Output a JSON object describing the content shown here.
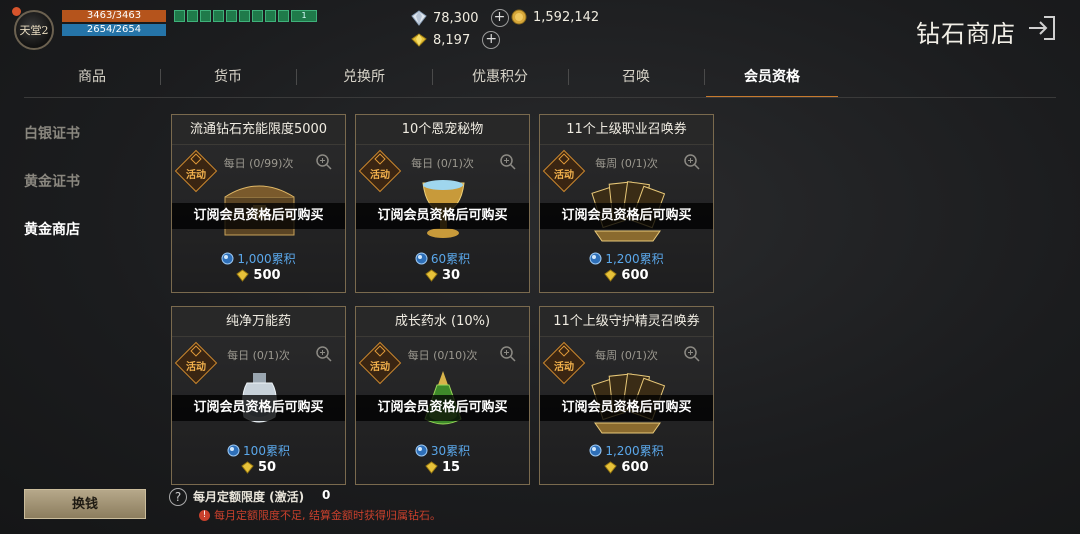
{
  "hud": {
    "avatar_text": "天堂2",
    "hp": "3463/3463",
    "mp": "2654/2654",
    "buff_tail": "1",
    "diamond": "78,300",
    "gold": "1,592,142",
    "gem": "8,197",
    "plus": "+"
  },
  "header": {
    "title": "钻石商店"
  },
  "tabs": [
    {
      "label": "商品"
    },
    {
      "label": "货币"
    },
    {
      "label": "兑换所"
    },
    {
      "label": "优惠积分"
    },
    {
      "label": "召唤"
    },
    {
      "label": "会员资格",
      "active": true
    }
  ],
  "sidebar": {
    "items": [
      {
        "label": "白银证书"
      },
      {
        "label": "黄金证书"
      },
      {
        "label": "黄金商店",
        "active": true
      }
    ]
  },
  "cards": [
    {
      "title": "流通钻石充能限度5000",
      "badge": "活动",
      "limit": "每日 (0/99)次",
      "locked": "订阅会员资格后可购买",
      "points": "1,000累积",
      "price": "500",
      "art": "chest"
    },
    {
      "title": "10个恩宠秘物",
      "badge": "活动",
      "limit": "每日 (0/1)次",
      "locked": "订阅会员资格后可购买",
      "points": "60累积",
      "price": "30",
      "art": "chalice"
    },
    {
      "title": "11个上级职业召唤券",
      "badge": "活动",
      "limit": "每周 (0/1)次",
      "locked": "订阅会员资格后可购买",
      "points": "1,200累积",
      "price": "600",
      "art": "cards"
    },
    {
      "title": "纯净万能药",
      "badge": "活动",
      "limit": "每日 (0/1)次",
      "locked": "订阅会员资格后可购买",
      "points": "100累积",
      "price": "50",
      "art": "potion-silver"
    },
    {
      "title": "成长药水 (10%)",
      "badge": "活动",
      "limit": "每日 (0/10)次",
      "locked": "订阅会员资格后可购买",
      "points": "30累积",
      "price": "15",
      "art": "potion-green"
    },
    {
      "title": "11个上级守护精灵召唤券",
      "badge": "活动",
      "limit": "每周 (0/1)次",
      "locked": "订阅会员资格后可购买",
      "points": "1,200累积",
      "price": "600",
      "art": "cards"
    }
  ],
  "bottom": {
    "exchange_label": "换钱",
    "help": "?",
    "quota_label": "每月定额限度 (激活)",
    "quota_value": "0",
    "warning": "每月定额限度不足, 结算金额时获得归属钻石。",
    "warn_icon": "!"
  },
  "colors": {
    "accent": "#c77a2e",
    "points_blue": "#5aa7ea",
    "badge_orange": "#f3b24d",
    "warning_red": "#c9402c"
  }
}
